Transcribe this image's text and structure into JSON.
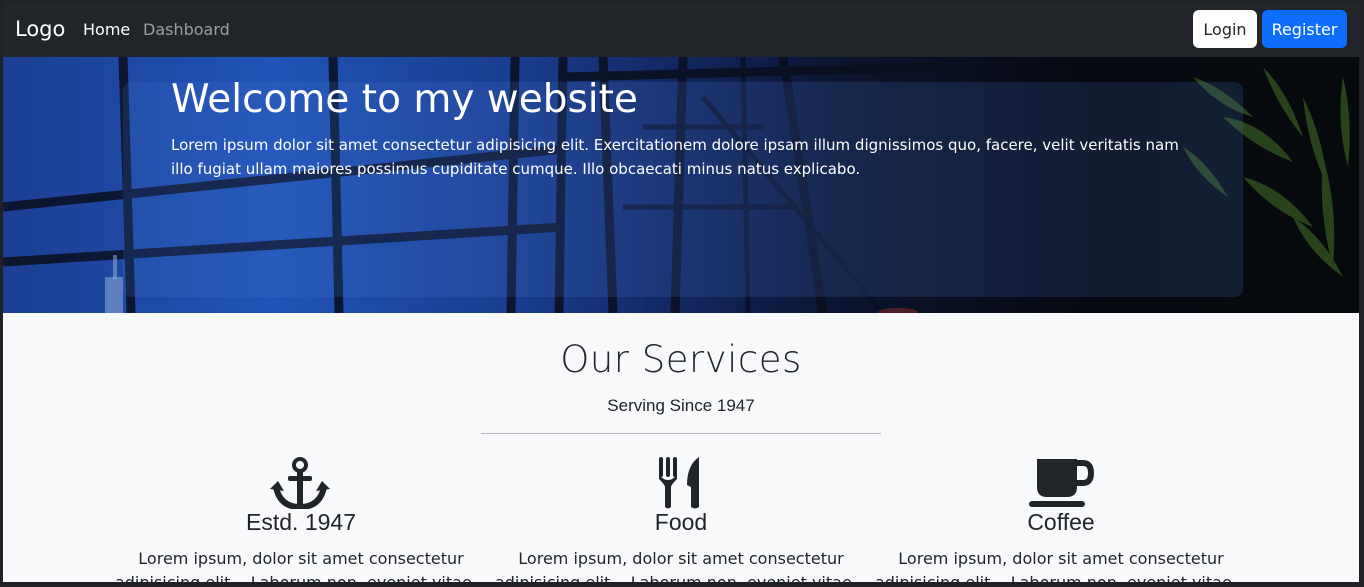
{
  "navbar": {
    "brand": "Logo",
    "links": [
      {
        "label": "Home",
        "active": true
      },
      {
        "label": "Dashboard",
        "active": false
      }
    ],
    "login_label": "Login",
    "register_label": "Register"
  },
  "hero": {
    "title": "Welcome to my website",
    "text": "Lorem ipsum dolor sit amet consectetur adipisicing elit. Exercitationem dolore ipsam illum dignissimos quo, facere, velit veritatis nam illo fugiat ullam maiores possimus cupiditate cumque. Illo obcaecati minus natus explicabo."
  },
  "services": {
    "title": "Our Services",
    "subtitle": "Serving Since 1947",
    "items": [
      {
        "icon": "anchor-icon",
        "title": "Estd. 1947",
        "text": "Lorem ipsum, dolor sit amet consectetur adipisicing elit... Laborum non, eveniet vitae..."
      },
      {
        "icon": "utensils-icon",
        "title": "Food",
        "text": "Lorem ipsum, dolor sit amet consectetur adipisicing elit... Laborum non, eveniet vitae..."
      },
      {
        "icon": "coffee-cup-icon",
        "title": "Coffee",
        "text": "Lorem ipsum, dolor sit amet consectetur adipisicing elit... Laborum non, eveniet vitae..."
      }
    ]
  },
  "colors": {
    "navbar_bg": "#212529",
    "primary": "#0d6efd",
    "page_bg": "#f8f9fa",
    "text": "#212529"
  }
}
